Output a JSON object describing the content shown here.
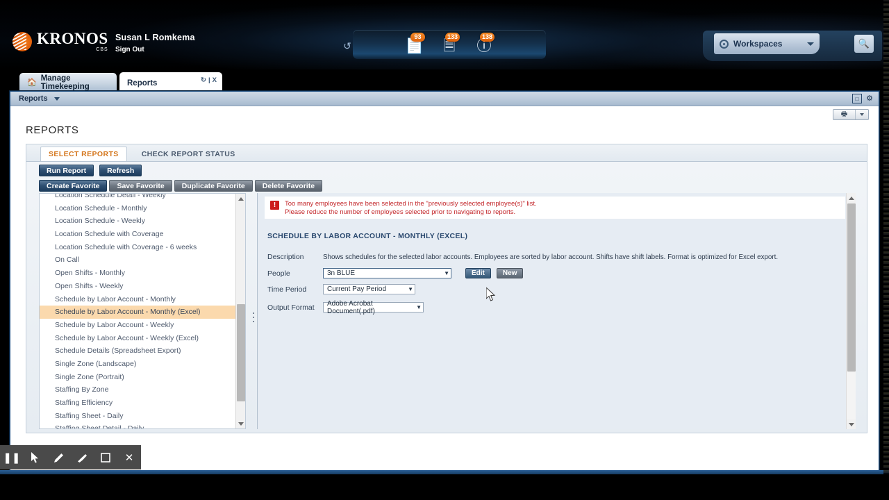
{
  "header": {
    "brand_name": "KRONOS",
    "brand_sub": "CBS",
    "user_name": "Susan L Romkema",
    "sign_out": "Sign Out",
    "refresh_icon": "refresh-icon",
    "alerts": [
      {
        "icon": "timecard-approval-icon",
        "count": "93"
      },
      {
        "icon": "exceptions-list-icon",
        "count": "133"
      },
      {
        "icon": "alerts-warning-icon",
        "count": "138"
      }
    ],
    "workspaces_label": "Workspaces",
    "search_icon": "search-icon"
  },
  "workspace_tabs": [
    {
      "label": "Manage Timekeeping",
      "icon": "home-icon",
      "active": false
    },
    {
      "label": "Reports",
      "icon": "",
      "active": true
    }
  ],
  "tab_actions": {
    "refresh": "↻",
    "separator": "|",
    "close": "X"
  },
  "window": {
    "menu_label": "Reports",
    "restore_icon": "restore-window-icon",
    "gear_icon": "gear-icon",
    "print_icon": "print-icon"
  },
  "page_title": "REPORTS",
  "panel_tabs": [
    {
      "label": "SELECT REPORTS",
      "active": true
    },
    {
      "label": "CHECK REPORT STATUS",
      "active": false
    }
  ],
  "actions_primary": [
    {
      "label": "Run Report"
    },
    {
      "label": "Refresh"
    }
  ],
  "actions_favorites": [
    {
      "label": "Create Favorite",
      "primary": true
    },
    {
      "label": "Save Favorite",
      "primary": false
    },
    {
      "label": "Duplicate Favorite",
      "primary": false
    },
    {
      "label": "Delete Favorite",
      "primary": false
    }
  ],
  "report_list": {
    "items": [
      {
        "label": "Location Schedule Detail - Weekly",
        "selected": false
      },
      {
        "label": "Location Schedule - Monthly",
        "selected": false
      },
      {
        "label": "Location Schedule - Weekly",
        "selected": false
      },
      {
        "label": "Location Schedule with Coverage",
        "selected": false
      },
      {
        "label": "Location Schedule with Coverage - 6 weeks",
        "selected": false
      },
      {
        "label": "On Call",
        "selected": false
      },
      {
        "label": "Open Shifts - Monthly",
        "selected": false
      },
      {
        "label": "Open Shifts - Weekly",
        "selected": false
      },
      {
        "label": "Schedule by Labor Account - Monthly",
        "selected": false
      },
      {
        "label": "Schedule by Labor Account - Monthly (Excel)",
        "selected": true
      },
      {
        "label": "Schedule by Labor Account - Weekly",
        "selected": false
      },
      {
        "label": "Schedule by Labor Account - Weekly (Excel)",
        "selected": false
      },
      {
        "label": "Schedule Details (Spreadsheet Export)",
        "selected": false
      },
      {
        "label": "Single Zone (Landscape)",
        "selected": false
      },
      {
        "label": "Single Zone (Portrait)",
        "selected": false
      },
      {
        "label": "Staffing By Zone",
        "selected": false
      },
      {
        "label": "Staffing Efficiency",
        "selected": false
      },
      {
        "label": "Staffing Sheet - Daily",
        "selected": false
      },
      {
        "label": "Staffing Sheet Detail - Daily",
        "selected": false
      }
    ]
  },
  "detail": {
    "error": {
      "icon": "error-icon",
      "line1": "Too many employees have been selected in the \"previously selected employee(s)\" list.",
      "line2": "Please reduce the number of employees selected prior to navigating to reports."
    },
    "title": "SCHEDULE BY LABOR ACCOUNT - MONTHLY (EXCEL)",
    "fields": {
      "description_label": "Description",
      "description_value": "Shows schedules for the selected labor accounts. Employees are sorted by labor account. Shifts have shift labels. Format is optimized for Excel export.",
      "people_label": "People",
      "people_value": "3n BLUE",
      "edit_label": "Edit",
      "new_label": "New",
      "time_period_label": "Time Period",
      "time_period_value": "Current Pay Period",
      "output_format_label": "Output Format",
      "output_format_value": "Adobe Acrobat Document(.pdf)"
    }
  },
  "annotation_toolbar": [
    {
      "icon": "pause-icon",
      "glyph": "❘❘"
    },
    {
      "icon": "cursor-arrow-icon",
      "glyph": "➤"
    },
    {
      "icon": "pencil-icon",
      "glyph": "✐"
    },
    {
      "icon": "eraser-icon",
      "glyph": "◥"
    },
    {
      "icon": "rectangle-icon",
      "glyph": "□"
    },
    {
      "icon": "close-icon",
      "glyph": "✕"
    }
  ],
  "colors": {
    "accent_orange": "#e0620c",
    "selected_row": "#fbd9ad",
    "error_red": "#c3262a",
    "primary_blue": "#2e4f72",
    "tab_active_text": "#d4761c"
  }
}
